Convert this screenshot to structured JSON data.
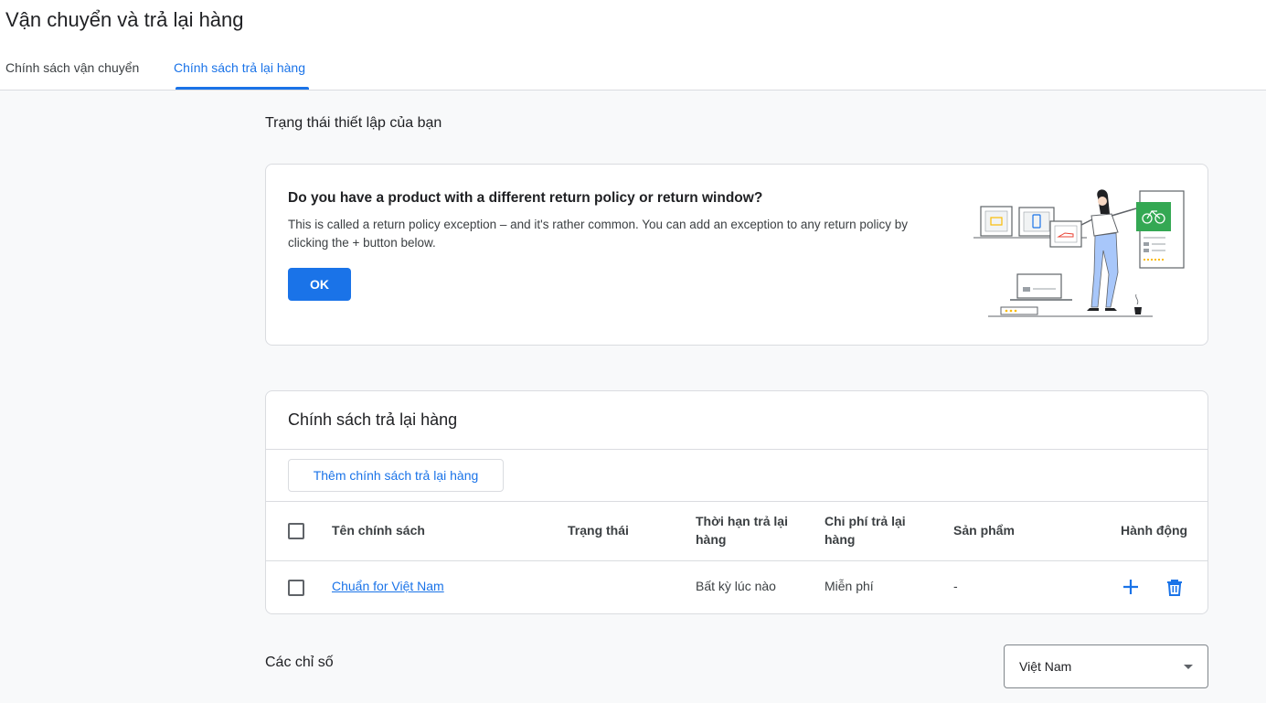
{
  "page": {
    "title": "Vận chuyển và trả lại hàng",
    "tabs": [
      {
        "label": "Chính sách vận chuyển",
        "active": false
      },
      {
        "label": "Chính sách trả lại hàng",
        "active": true
      }
    ]
  },
  "setup_status": {
    "heading": "Trạng thái thiết lập của bạn"
  },
  "promo": {
    "title": "Do you have a product with a different return policy or return window?",
    "body": "This is called a return policy exception – and it's rather common. You can add an exception to any return policy by clicking the + button below.",
    "ok_label": "OK"
  },
  "return_policies": {
    "title": "Chính sách trả lại hàng",
    "add_button": "Thêm chính sách trả lại hàng",
    "columns": {
      "name": "Tên chính sách",
      "status": "Trạng thái",
      "window": "Thời hạn trả lại hàng",
      "cost": "Chi phí trả lại hàng",
      "products": "Sản phẩm",
      "actions": "Hành động"
    },
    "rows": [
      {
        "name": "Chuẩn for Việt Nam",
        "status": "",
        "window": "Bất kỳ lúc nào",
        "cost": "Miễn phí",
        "products": "-",
        "actions": [
          "add-icon",
          "delete-icon"
        ]
      }
    ]
  },
  "metrics": {
    "heading": "Các chỉ số",
    "country_select": "Việt Nam"
  },
  "colors": {
    "accent": "#1a73e8",
    "illustration_green": "#34a853",
    "illustration_yellow": "#fbbc04"
  }
}
